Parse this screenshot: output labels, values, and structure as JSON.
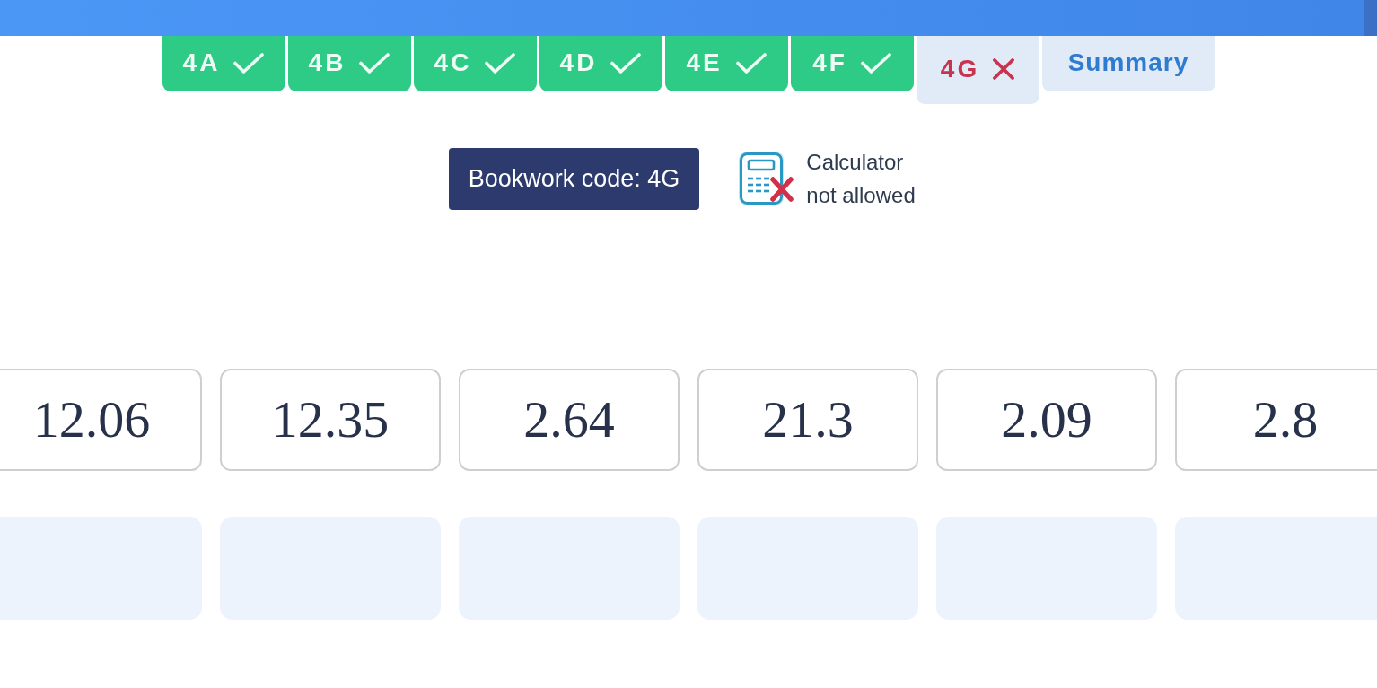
{
  "tabs": [
    {
      "label": "4A",
      "kind": "task",
      "correct": true,
      "selected": false
    },
    {
      "label": "4B",
      "kind": "task",
      "correct": true,
      "selected": false
    },
    {
      "label": "4C",
      "kind": "task",
      "correct": true,
      "selected": false
    },
    {
      "label": "4D",
      "kind": "task",
      "correct": true,
      "selected": false
    },
    {
      "label": "4E",
      "kind": "task",
      "correct": true,
      "selected": false
    },
    {
      "label": "4F",
      "kind": "task",
      "correct": true,
      "selected": false
    },
    {
      "label": "4G",
      "kind": "task",
      "correct": false,
      "selected": true
    },
    {
      "label": "Summary",
      "kind": "summary",
      "selected": false
    }
  ],
  "bookwork": {
    "label": "Bookwork code: 4G"
  },
  "calculator": {
    "allowed": false,
    "text": "Calculator not allowed"
  },
  "answer_cards": [
    "12.06",
    "12.35",
    "2.64",
    "21.3",
    "2.09",
    "2.8"
  ],
  "drop_slots": [
    {
      "filled": false
    },
    {
      "filled": false
    },
    {
      "filled": false
    },
    {
      "filled": false
    },
    {
      "filled": false
    },
    {
      "filled": false
    }
  ]
}
